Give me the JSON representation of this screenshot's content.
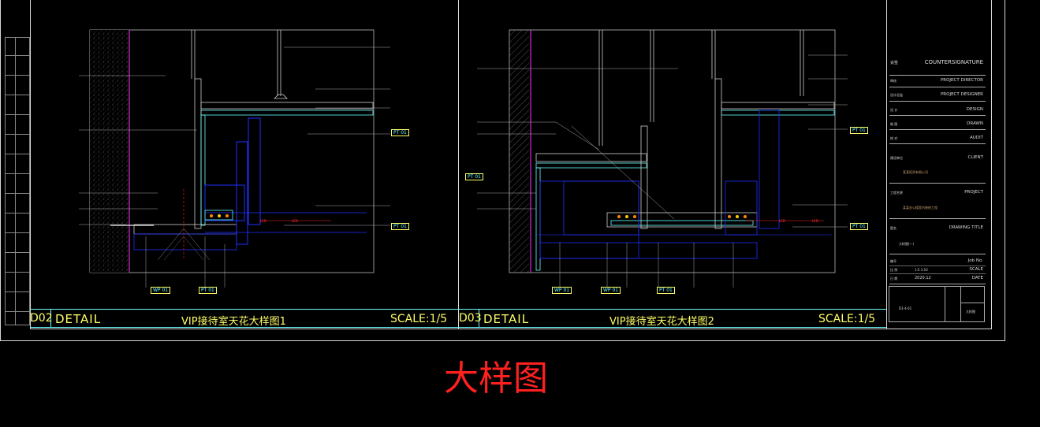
{
  "caption": "大样图",
  "colors": {
    "background": "#000000",
    "frame": "#d8d8d8",
    "title_bar": "#66ffff",
    "title_text": "#ffff66",
    "caption": "#ff2020",
    "magenta_line": "#ff33ff",
    "blue_dim": "#2030ff",
    "annotation": "#c8a070"
  },
  "details": [
    {
      "code": "D02",
      "label": "DETAIL",
      "title": "VIP接待室天花大样图1",
      "scale": "SCALE:1/5",
      "tags": [
        "PT 01",
        "PT 01",
        "WP 01",
        "PT 01"
      ],
      "led": [
        "LED",
        "LED"
      ]
    },
    {
      "code": "D03",
      "label": "DETAIL",
      "title": "VIP接待室天花大样图2",
      "scale": "SCALE:1/5",
      "tags": [
        "PT 01",
        "PT 01",
        "PT 01",
        "WP 01",
        "WP 01",
        "PT 01"
      ],
      "led": [
        "LED",
        "LED"
      ]
    }
  ],
  "title_block": {
    "countersign_key": "会签",
    "countersign": "COUNTERSIGNATURE",
    "rows": [
      {
        "key": "审核",
        "value": "PROJECT DIRECTOR"
      },
      {
        "key": "设计总监",
        "value": "PROJECT DESIGNER"
      },
      {
        "key": "设 计",
        "value": "DESIGN"
      },
      {
        "key": "制 图",
        "value": "DRAWN"
      },
      {
        "key": "校 对",
        "value": "AUDIT"
      },
      {
        "key": "建设单位",
        "value": "CLIENT"
      },
      {
        "key": "工程名称",
        "value": "PROJECT"
      },
      {
        "key": "图名",
        "value": "DRAWING TITLE"
      }
    ],
    "client_name": "某某投资有限公司",
    "project_name": "某某办公楼室内装修工程",
    "drawing_title": "大样图(一)",
    "job_no_key": "编号",
    "job_no": "Job No.",
    "scale_key": "比 例",
    "scale_value": "1:5  1:10",
    "scale_label": "SCALE",
    "date_key": "日 期",
    "date_value": "2020.12",
    "date_label": "DATE",
    "sheet_left": "D1-4-01",
    "sheet_right": "大样图"
  }
}
